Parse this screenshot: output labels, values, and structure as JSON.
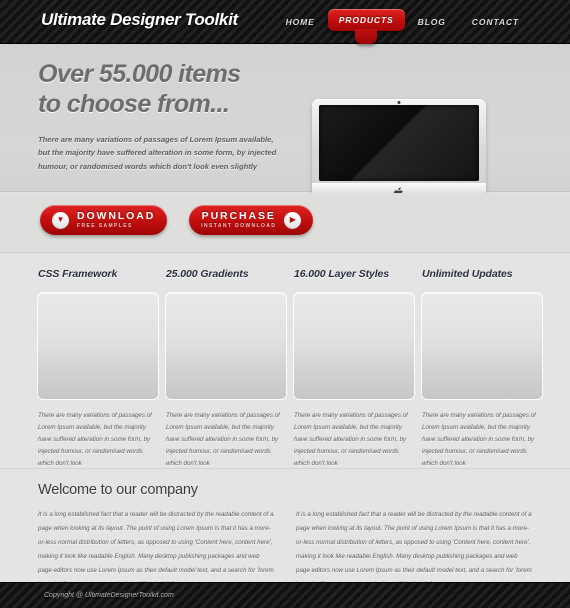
{
  "site": {
    "logo": "Ultimate Designer Toolkit"
  },
  "nav": {
    "items": [
      {
        "label": "HOME",
        "active": false
      },
      {
        "label": "PRODUCTS",
        "active": true
      },
      {
        "label": "BLOG",
        "active": false
      },
      {
        "label": "CONTACT",
        "active": false
      }
    ]
  },
  "hero": {
    "title_line1": "Over 55.000 items",
    "title_line2": "to choose from...",
    "subtitle": "There are many variations of passages of Lorem Ipsum available, but the majority have suffered alteration in some form, by injected humour, or randomised words which don't look even slightly",
    "image": "imac-computer",
    "apple_logo": ""
  },
  "buttons": [
    {
      "main": "DOWNLOAD",
      "sub": "FREE SAMPLES",
      "icon": "down-arrow-icon",
      "glyph": "▼",
      "icon_side": "left"
    },
    {
      "main": "PURCHASE",
      "sub": "INSTANT DOWNLOAD",
      "icon": "right-arrow-icon",
      "glyph": "▶",
      "icon_side": "right"
    }
  ],
  "features": [
    {
      "title": "CSS Framework",
      "text": "There are many variations of passages of Lorem Ipsum available, but the majority have suffered alteration in some form, by injected humour, or randomised words which don't look"
    },
    {
      "title": "25.000 Gradients",
      "text": "There are many variations of passages of Lorem Ipsum available, but the majority have suffered alteration in some form, by injected humour, or randomised words which don't look"
    },
    {
      "title": "16.000 Layer Styles",
      "text": "There are many variations of passages of Lorem Ipsum available, but the majority have suffered alteration in some form, by injected humour, or randomised words which don't look"
    },
    {
      "title": "Unlimited Updates",
      "text": "There are many variations of passages of Lorem Ipsum available, but the majority have suffered alteration in some form, by injected humour, or randomised words which don't look"
    }
  ],
  "welcome": {
    "title": "Welcome to our company",
    "column_left": "It is a long established fact that a reader will be distracted by the readable content of a page when looking at its layout. The point of using Lorem Ipsum is that it has a more-or-less normal distribution of letters, as opposed to using 'Content here, content here', making it look like readable English. Many desktop publishing packages and web page editors now use Lorem Ipsum as their default model text, and a search for 'lorem ipsum' will uncover many web sites still in their infancy.",
    "column_right": "It is a long established fact that a reader will be distracted by the readable content of a page when looking at its layout. The point of using Lorem Ipsum is that it has a more-or-less normal distribution of letters, as opposed to using 'Content here, content here', making it look like readable English. Many desktop publishing packages and web page editors now use Lorem Ipsum as their default model text, and a search for 'lorem ipsum' will uncover many web sites still in their infancy."
  },
  "footer": {
    "copyright": "Copyright @ UltimateDesignerToolkit.com"
  },
  "colors": {
    "accent_red": "#c40f0f",
    "header_dark": "#1a1a1a",
    "hero_bg": "#d5d5d5",
    "body_bg": "#e4e4e4",
    "heading_navy": "#2a2f3f"
  }
}
